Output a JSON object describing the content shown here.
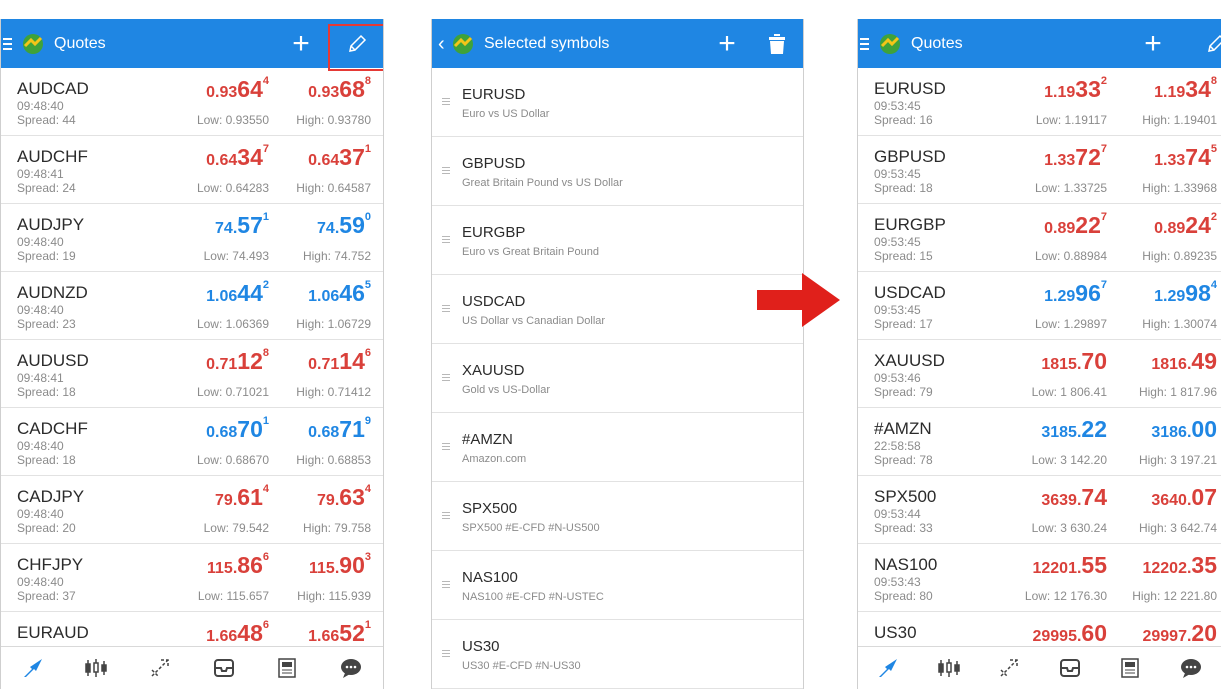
{
  "colors": {
    "accent": "#1f86e3",
    "price_up": "#1f86e3",
    "price_down": "#d9403a",
    "highlight": "#e53935"
  },
  "icons": [
    "menu-icon",
    "app-logo-icon",
    "plus-icon",
    "pencil-icon",
    "back-icon",
    "trash-icon",
    "quotes-nav-icon",
    "chart-nav-icon",
    "trade-nav-icon",
    "history-nav-icon",
    "news-nav-icon",
    "chat-nav-icon",
    "arrow-right-icon"
  ],
  "left": {
    "title": "Quotes",
    "rows": [
      {
        "symbol": "AUDCAD",
        "time": "09:48:40",
        "spread": "Spread: 44",
        "bid_pre": "0.93",
        "bid_big": "64",
        "bid_sup": "4",
        "bid_color": "red",
        "ask_pre": "0.93",
        "ask_big": "68",
        "ask_sup": "8",
        "ask_color": "red",
        "low": "Low: 0.93550",
        "high": "High: 0.93780"
      },
      {
        "symbol": "AUDCHF",
        "time": "09:48:41",
        "spread": "Spread: 24",
        "bid_pre": "0.64",
        "bid_big": "34",
        "bid_sup": "7",
        "bid_color": "red",
        "ask_pre": "0.64",
        "ask_big": "37",
        "ask_sup": "1",
        "ask_color": "red",
        "low": "Low: 0.64283",
        "high": "High: 0.64587"
      },
      {
        "symbol": "AUDJPY",
        "time": "09:48:40",
        "spread": "Spread: 19",
        "bid_pre": "74.",
        "bid_big": "57",
        "bid_sup": "1",
        "bid_color": "blue",
        "ask_pre": "74.",
        "ask_big": "59",
        "ask_sup": "0",
        "ask_color": "blue",
        "low": "Low: 74.493",
        "high": "High: 74.752"
      },
      {
        "symbol": "AUDNZD",
        "time": "09:48:40",
        "spread": "Spread: 23",
        "bid_pre": "1.06",
        "bid_big": "44",
        "bid_sup": "2",
        "bid_color": "blue",
        "ask_pre": "1.06",
        "ask_big": "46",
        "ask_sup": "5",
        "ask_color": "blue",
        "low": "Low: 1.06369",
        "high": "High: 1.06729"
      },
      {
        "symbol": "AUDUSD",
        "time": "09:48:41",
        "spread": "Spread: 18",
        "bid_pre": "0.71",
        "bid_big": "12",
        "bid_sup": "8",
        "bid_color": "red",
        "ask_pre": "0.71",
        "ask_big": "14",
        "ask_sup": "6",
        "ask_color": "red",
        "low": "Low: 0.71021",
        "high": "High: 0.71412"
      },
      {
        "symbol": "CADCHF",
        "time": "09:48:40",
        "spread": "Spread: 18",
        "bid_pre": "0.68",
        "bid_big": "70",
        "bid_sup": "1",
        "bid_color": "blue",
        "ask_pre": "0.68",
        "ask_big": "71",
        "ask_sup": "9",
        "ask_color": "blue",
        "low": "Low: 0.68670",
        "high": "High: 0.68853"
      },
      {
        "symbol": "CADJPY",
        "time": "09:48:40",
        "spread": "Spread: 20",
        "bid_pre": "79.",
        "bid_big": "61",
        "bid_sup": "4",
        "bid_color": "red",
        "ask_pre": "79.",
        "ask_big": "63",
        "ask_sup": "4",
        "ask_color": "red",
        "low": "Low: 79.542",
        "high": "High: 79.758"
      },
      {
        "symbol": "CHFJPY",
        "time": "09:48:40",
        "spread": "Spread: 37",
        "bid_pre": "115.",
        "bid_big": "86",
        "bid_sup": "6",
        "bid_color": "red",
        "ask_pre": "115.",
        "ask_big": "90",
        "ask_sup": "3",
        "ask_color": "red",
        "low": "Low: 115.657",
        "high": "High: 115.939"
      },
      {
        "symbol": "EURAUD",
        "time": "",
        "spread": "",
        "bid_pre": "1.66",
        "bid_big": "48",
        "bid_sup": "6",
        "bid_color": "red",
        "ask_pre": "1.66",
        "ask_big": "52",
        "ask_sup": "1",
        "ask_color": "red",
        "low": "",
        "high": ""
      }
    ]
  },
  "middle": {
    "title": "Selected symbols",
    "rows": [
      {
        "name": "EURUSD",
        "desc": "Euro vs US Dollar"
      },
      {
        "name": "GBPUSD",
        "desc": "Great Britain Pound vs US Dollar"
      },
      {
        "name": "EURGBP",
        "desc": "Euro vs Great Britain Pound"
      },
      {
        "name": "USDCAD",
        "desc": "US Dollar vs Canadian Dollar"
      },
      {
        "name": "XAUUSD",
        "desc": "Gold vs US-Dollar"
      },
      {
        "name": "#AMZN",
        "desc": "Amazon.com"
      },
      {
        "name": "SPX500",
        "desc": "SPX500 #E-CFD #N-US500"
      },
      {
        "name": "NAS100",
        "desc": "NAS100 #E-CFD #N-USTEC"
      },
      {
        "name": "US30",
        "desc": "US30 #E-CFD #N-US30"
      }
    ]
  },
  "right": {
    "title": "Quotes",
    "rows": [
      {
        "symbol": "EURUSD",
        "time": "09:53:45",
        "spread": "Spread: 16",
        "bid_pre": "1.19",
        "bid_big": "33",
        "bid_sup": "2",
        "bid_color": "red",
        "ask_pre": "1.19",
        "ask_big": "34",
        "ask_sup": "8",
        "ask_color": "red",
        "low": "Low: 1.19117",
        "high": "High: 1.19401"
      },
      {
        "symbol": "GBPUSD",
        "time": "09:53:45",
        "spread": "Spread: 18",
        "bid_pre": "1.33",
        "bid_big": "72",
        "bid_sup": "7",
        "bid_color": "red",
        "ask_pre": "1.33",
        "ask_big": "74",
        "ask_sup": "5",
        "ask_color": "red",
        "low": "Low: 1.33725",
        "high": "High: 1.33968"
      },
      {
        "symbol": "EURGBP",
        "time": "09:53:45",
        "spread": "Spread: 15",
        "bid_pre": "0.89",
        "bid_big": "22",
        "bid_sup": "7",
        "bid_color": "red",
        "ask_pre": "0.89",
        "ask_big": "24",
        "ask_sup": "2",
        "ask_color": "red",
        "low": "Low: 0.88984",
        "high": "High: 0.89235"
      },
      {
        "symbol": "USDCAD",
        "time": "09:53:45",
        "spread": "Spread: 17",
        "bid_pre": "1.29",
        "bid_big": "96",
        "bid_sup": "7",
        "bid_color": "blue",
        "ask_pre": "1.29",
        "ask_big": "98",
        "ask_sup": "4",
        "ask_color": "blue",
        "low": "Low: 1.29897",
        "high": "High: 1.30074"
      },
      {
        "symbol": "XAUUSD",
        "time": "09:53:46",
        "spread": "Spread: 79",
        "bid_pre": "1815.",
        "bid_big": "70",
        "bid_sup": "",
        "bid_color": "red",
        "ask_pre": "1816.",
        "ask_big": "49",
        "ask_sup": "",
        "ask_color": "red",
        "low": "Low: 1 806.41",
        "high": "High: 1 817.96"
      },
      {
        "symbol": "#AMZN",
        "time": "22:58:58",
        "spread": "Spread: 78",
        "bid_pre": "3185.",
        "bid_big": "22",
        "bid_sup": "",
        "bid_color": "blue",
        "ask_pre": "3186.",
        "ask_big": "00",
        "ask_sup": "",
        "ask_color": "blue",
        "low": "Low: 3 142.20",
        "high": "High: 3 197.21"
      },
      {
        "symbol": "SPX500",
        "time": "09:53:44",
        "spread": "Spread: 33",
        "bid_pre": "3639.",
        "bid_big": "74",
        "bid_sup": "",
        "bid_color": "red",
        "ask_pre": "3640.",
        "ask_big": "07",
        "ask_sup": "",
        "ask_color": "red",
        "low": "Low: 3 630.24",
        "high": "High: 3 642.74"
      },
      {
        "symbol": "NAS100",
        "time": "09:53:43",
        "spread": "Spread: 80",
        "bid_pre": "12201.",
        "bid_big": "55",
        "bid_sup": "",
        "bid_color": "red",
        "ask_pre": "12202.",
        "ask_big": "35",
        "ask_sup": "",
        "ask_color": "red",
        "low": "Low: 12 176.30",
        "high": "High: 12 221.80"
      },
      {
        "symbol": "US30",
        "time": "",
        "spread": "",
        "bid_pre": "29995.",
        "bid_big": "60",
        "bid_sup": "",
        "bid_color": "red",
        "ask_pre": "29997.",
        "ask_big": "20",
        "ask_sup": "",
        "ask_color": "red",
        "low": "",
        "high": ""
      }
    ]
  }
}
